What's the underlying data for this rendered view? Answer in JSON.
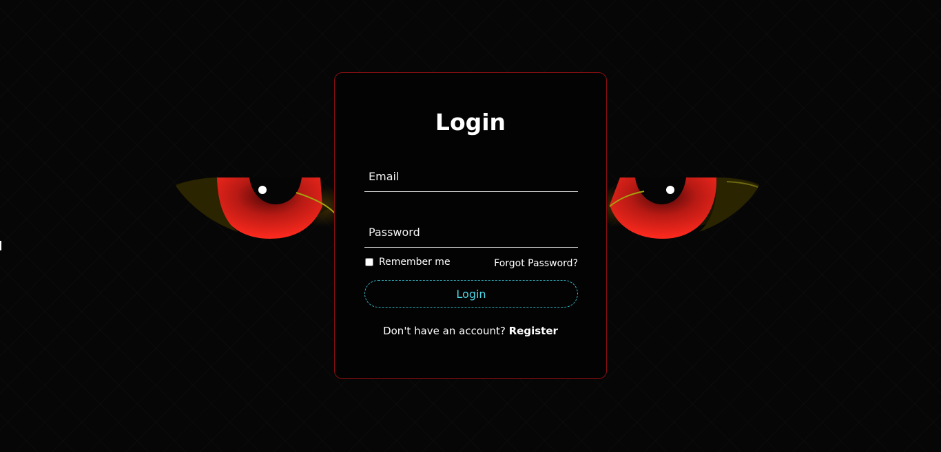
{
  "login_form": {
    "title": "Login",
    "email_placeholder": "Email",
    "password_placeholder": "Password",
    "remember_label": "Remember me",
    "remember_checked": false,
    "forgot_label": "Forgot Password?",
    "submit_label": "Login",
    "register_prompt": "Don't have an account?",
    "register_label": "Register"
  },
  "colors": {
    "background": "#060606",
    "card_border": "#8a0f12",
    "eye_iris": "#e8241c",
    "button_border": "#34b7c7",
    "button_text": "#4fd6e6",
    "text": "#ffffff"
  },
  "icons": [
    "left-eye-icon",
    "right-eye-icon"
  ]
}
